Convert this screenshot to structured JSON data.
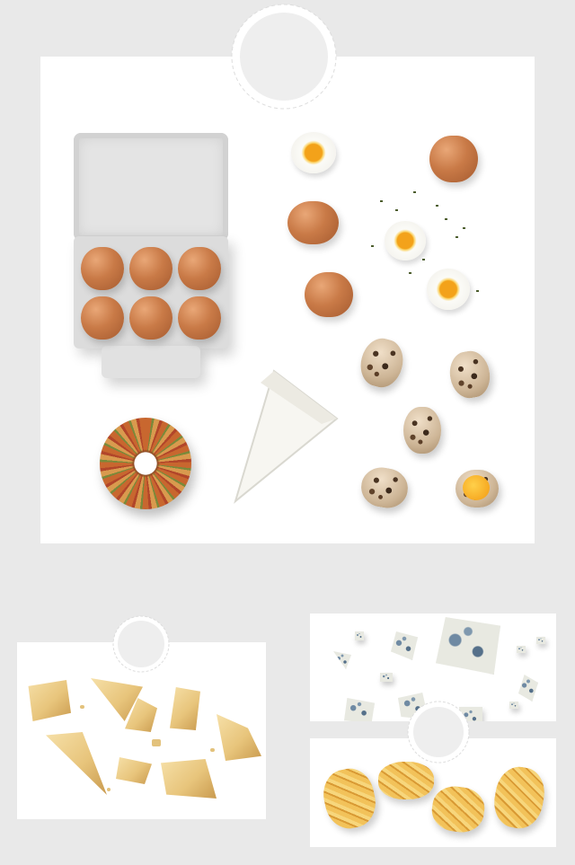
{
  "scene": {
    "background_color": "#e9e9e9",
    "panel_color": "#ffffff",
    "badge_color": "#eeeeee",
    "items": {
      "main_panel": [
        "egg-carton",
        "brown-eggs",
        "soft-boiled-egg-halves",
        "quail-eggs",
        "cracked-quail-egg",
        "seasoned-bagel",
        "brie-cheese-wedge"
      ],
      "bottom_left_panel": [
        "parmesan-chunks"
      ],
      "bottom_right_top_panel": [
        "blue-cheese-crumbles"
      ],
      "bottom_right_bottom_panel": [
        "tagliatelle-nests"
      ]
    }
  }
}
